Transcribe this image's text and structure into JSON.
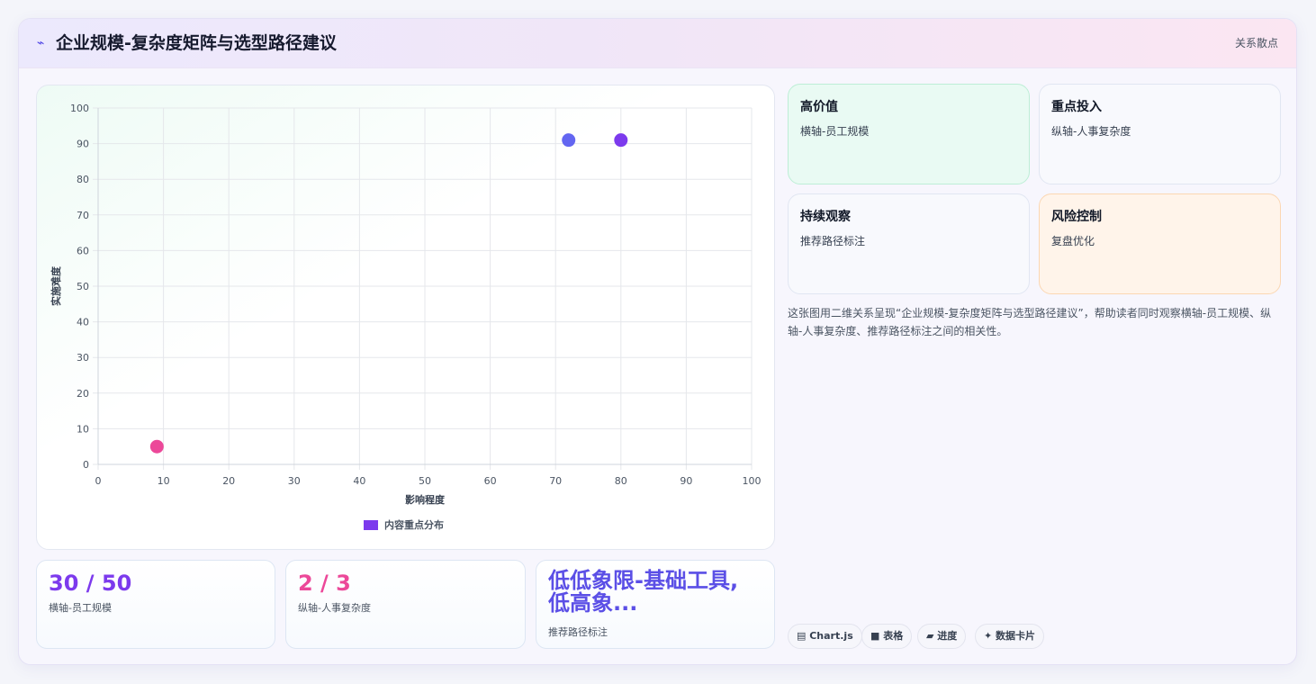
{
  "header": {
    "icon": "bolt-icon",
    "title": "企业规模-复杂度矩阵与选型路径建议",
    "tag": "关系散点"
  },
  "chart_data": {
    "type": "scatter",
    "xlabel": "影响程度",
    "ylabel": "实施难度",
    "xlim": [
      0,
      100
    ],
    "ylim": [
      0,
      100
    ],
    "xticks": [
      0,
      10,
      20,
      30,
      40,
      50,
      60,
      70,
      80,
      90,
      100
    ],
    "yticks": [
      0,
      10,
      20,
      30,
      40,
      50,
      60,
      70,
      80,
      90,
      100
    ],
    "grid": true,
    "legend": "bottom",
    "series": [
      {
        "name": "内容重点分布",
        "color": "#7c3aed",
        "points": [
          {
            "x": 9,
            "y": 5,
            "color": "#ec4899"
          },
          {
            "x": 72,
            "y": 91,
            "color": "#6366f1"
          },
          {
            "x": 80,
            "y": 91,
            "color": "#7c3aed"
          }
        ]
      }
    ]
  },
  "stats": [
    {
      "value": "30 / 50",
      "label": "横轴-员工规模",
      "color": "#7c3aed"
    },
    {
      "value": "2 / 3",
      "label": "纵轴-人事复杂度",
      "color": "#ec4899"
    },
    {
      "value": "低低象限-基础工具, 低高象...",
      "label": "推荐路径标注",
      "color": "#5b4fe6"
    }
  ],
  "quadrants": [
    {
      "title": "高价值",
      "subtitle": "横轴-员工规模"
    },
    {
      "title": "重点投入",
      "subtitle": "纵轴-人事复杂度"
    },
    {
      "title": "持续观察",
      "subtitle": "推荐路径标注"
    },
    {
      "title": "风险控制",
      "subtitle": "复盘优化"
    }
  ],
  "description": "这张图用二维关系呈现“企业规模-复杂度矩阵与选型路径建议”，帮助读者同时观察横轴-员工规模、纵轴-人事复杂度、推荐路径标注之间的相关性。",
  "pills": [
    {
      "icon": "chart-icon",
      "label": "Chart.js"
    },
    {
      "icon": "table-icon",
      "label": "表格"
    },
    {
      "icon": "progress-icon",
      "label": "进度"
    },
    {
      "icon": "sparkle-icon",
      "label": "数据卡片"
    }
  ]
}
